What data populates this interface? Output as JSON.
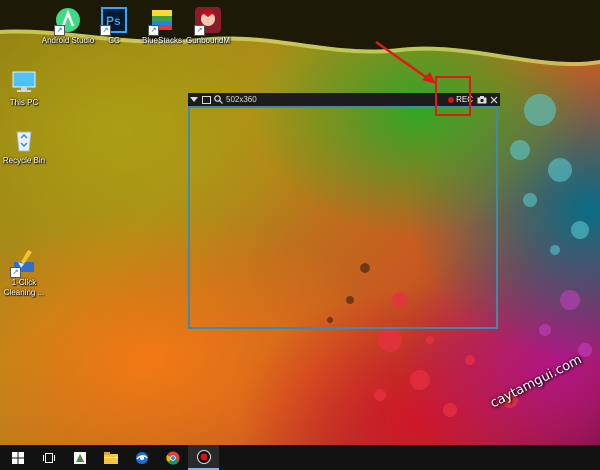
{
  "desktop": {
    "icons": [
      {
        "label": "Android Studio",
        "icon": "android-studio-icon"
      },
      {
        "label": "CC",
        "icon": "photoshop-icon"
      },
      {
        "label": "BlueStacks",
        "icon": "bluestacks-icon"
      },
      {
        "label": "GunboundM",
        "icon": "gunbound-icon"
      },
      {
        "label": "This PC",
        "icon": "this-pc-icon"
      },
      {
        "label": "Recycle Bin",
        "icon": "recycle-bin-icon"
      },
      {
        "label": "1-Click Cleaning ...",
        "icon": "cleaning-icon"
      }
    ]
  },
  "recorder": {
    "dimensions": "502x360",
    "rec_label": "REC",
    "accent": "#3f8aa8",
    "rec_color": "#e01010"
  },
  "annotation": {
    "highlight_color": "#e01818"
  },
  "taskbar": {
    "items": [
      "start-icon",
      "task-view-icon",
      "app-icon",
      "file-explorer-icon",
      "browser-icon",
      "chrome-icon",
      "record-icon"
    ]
  },
  "watermark": {
    "text": "caytamgui.com"
  }
}
